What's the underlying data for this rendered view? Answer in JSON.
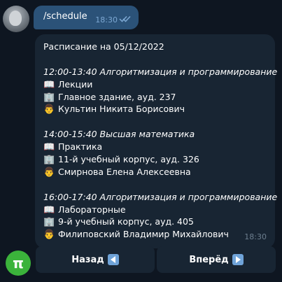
{
  "outgoing": {
    "text": "/schedule",
    "time": "18:30"
  },
  "schedule": {
    "title": "Расписание на 05/12/2022",
    "time": "18:30",
    "entries": [
      {
        "header": "12:00-13:40 Алгоритмизация и программирование",
        "type": "Лекции",
        "place": "Главное здание,  ауд. 237",
        "teacher": "Культин Никита Борисович"
      },
      {
        "header": "14:00-15:40 Высшая математика",
        "type": "Практика",
        "place": "11-й учебный корпус,  ауд. 326",
        "teacher": "Смирнова Елена Алексеевна"
      },
      {
        "header": "16:00-17:40 Алгоритмизация и программирование",
        "type": "Лабораторные",
        "place": "9-й учебный корпус,  ауд. 405",
        "teacher": "Филиповский Владимир Михайлович"
      }
    ],
    "icons": {
      "type": "📖",
      "place": "🏢",
      "teacher": "👨"
    }
  },
  "bot_avatar": {
    "symbol": "π",
    "color": "#3bb33b"
  },
  "keyboard": {
    "back_label": "Назад",
    "forward_label": "Вперёд"
  }
}
